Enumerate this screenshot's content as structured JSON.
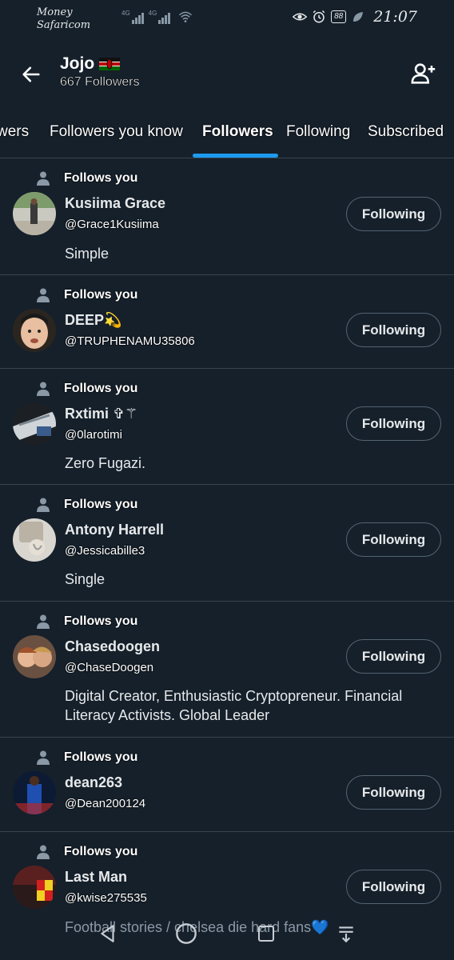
{
  "status": {
    "carrier_line1": "Money",
    "carrier_line2": "Safaricom",
    "network1": "4G",
    "network2": "4G",
    "battery": "88",
    "time": "21:07"
  },
  "header": {
    "title": "Jojo",
    "followers_count": "667 Followers"
  },
  "tabs": [
    {
      "label": "wers"
    },
    {
      "label": "Followers you know"
    },
    {
      "label": "Followers"
    },
    {
      "label": "Following"
    },
    {
      "label": "Subscribed"
    }
  ],
  "followers": [
    {
      "follows_label": "Follows you",
      "name": "Kusiima Grace",
      "handle": "@Grace1Kusiima",
      "bio": "Simple",
      "button": "Following"
    },
    {
      "follows_label": "Follows you",
      "name": "DEEP💫",
      "handle": "@TRUPHENAMU35806",
      "bio": "",
      "button": "Following"
    },
    {
      "follows_label": "Follows you",
      "name": "Rxtimi ✞⚚",
      "handle": "@0larotimi",
      "bio": "Zero Fugazi.",
      "button": "Following"
    },
    {
      "follows_label": "Follows you",
      "name": "Antony Harrell",
      "handle": "@Jessicabille3",
      "bio": "Single",
      "button": "Following"
    },
    {
      "follows_label": "Follows you",
      "name": "Chasedoogen",
      "handle": "@ChaseDoogen",
      "bio": "Digital Creator, Enthusiastic Cryptopreneur. Financial Literacy Activists. Global Leader",
      "button": "Following"
    },
    {
      "follows_label": "Follows you",
      "name": "dean263",
      "handle": "@Dean200124",
      "bio": "",
      "button": "Following"
    },
    {
      "follows_label": "Follows you",
      "name": "Last Man",
      "handle": "@kwise275535",
      "bio": "Football stories / chelsea die hard fans💙",
      "button": "Following"
    }
  ],
  "colors": {
    "background": "#15202b",
    "accent": "#1d9bf0",
    "divider": "#38444d"
  }
}
